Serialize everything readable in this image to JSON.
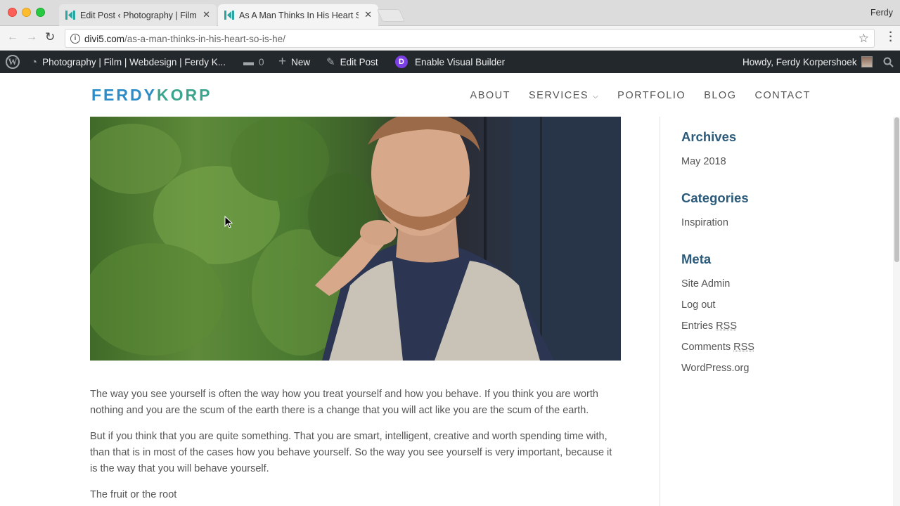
{
  "browser": {
    "tabs": [
      {
        "title": "Edit Post ‹ Photography | Film",
        "active": false
      },
      {
        "title": "As A Man Thinks In His Heart S",
        "active": true
      }
    ],
    "profile_name": "Ferdy",
    "url_host": "divi5.com",
    "url_path": "/as-a-man-thinks-in-his-heart-so-is-he/"
  },
  "admin_bar": {
    "site_name": "Photography | Film | Webdesign | Ferdy K...",
    "comments_count": "0",
    "new_label": "New",
    "edit_post_label": "Edit Post",
    "visual_builder_label": "Enable Visual Builder",
    "howdy_label": "Howdy, Ferdy Korpershoek"
  },
  "site": {
    "logo_part1": "FERDY",
    "logo_part2": "KORP",
    "nav": [
      "ABOUT",
      "SERVICES",
      "PORTFOLIO",
      "BLOG",
      "CONTACT"
    ]
  },
  "article": {
    "paragraphs": [
      "The way you see yourself is often the way how you treat yourself and how you behave. If you think you are worth nothing and you are the scum of the earth there is a change that you will act like you are the scum of the earth.",
      "But if you think that you are quite something. That you are smart, intelligent, creative and worth spending time with, than that is in most of the cases how you behave yourself. So the way you see yourself is very important, because it is the way that you will behave yourself.",
      "The fruit or the root"
    ]
  },
  "sidebar": {
    "archives_title": "Archives",
    "archives": [
      "May 2018"
    ],
    "categories_title": "Categories",
    "categories": [
      "Inspiration"
    ],
    "meta_title": "Meta",
    "meta": {
      "site_admin": "Site Admin",
      "log_out": "Log out",
      "entries": "Entries",
      "comments": "Comments",
      "rss": "RSS",
      "wordpress": "WordPress.org"
    }
  },
  "colors": {
    "logo_blue": "#2c8cc8",
    "logo_green": "#3aa58c",
    "admin_bar": "#23282d",
    "widget_title": "#2b5a7a",
    "divi_purple": "#7b3fe4"
  }
}
